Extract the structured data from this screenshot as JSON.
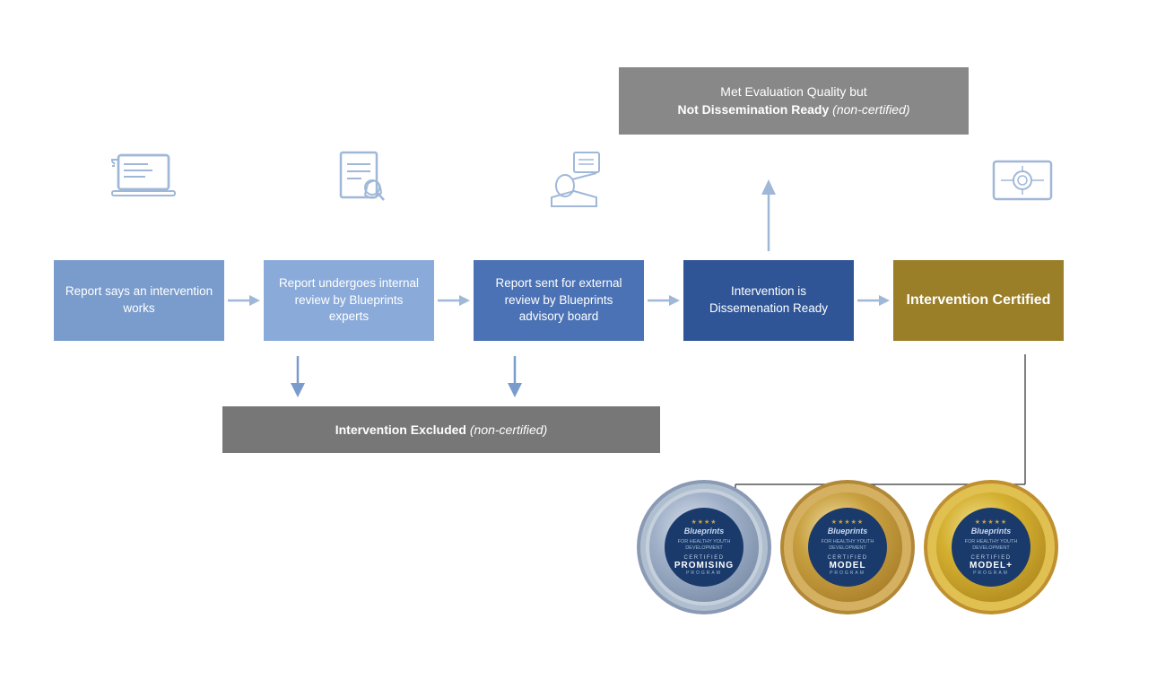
{
  "diagram": {
    "topBox": {
      "line1": "Met Evaluation Quality but",
      "line2Bold": "Not Dissemination Ready",
      "line2Italic": "(non-certified)"
    },
    "flowBoxes": [
      {
        "id": "box1",
        "text": "Report says an intervention works"
      },
      {
        "id": "box2",
        "text": "Report undergoes internal review by Blueprints experts"
      },
      {
        "id": "box3",
        "text": "Report sent for external review by Blueprints advisory board"
      },
      {
        "id": "box4",
        "text": "Intervention is Dissemenation Ready"
      },
      {
        "id": "box5",
        "text": "Intervention Certified"
      }
    ],
    "excludedBox": {
      "bold": "Intervention Excluded",
      "italic": "(non-certified)"
    },
    "badges": [
      {
        "type": "promising",
        "label": "CERTIFIED",
        "sub": "PROMISING",
        "program": "PROGRAM"
      },
      {
        "type": "model",
        "label": "CERTIFIED",
        "sub": "MODEL",
        "program": "PROGRAM"
      },
      {
        "type": "modelplus",
        "label": "CERTIFIED",
        "sub": "MODEL+",
        "program": "PROGRAM"
      }
    ],
    "icons": [
      {
        "name": "laptop-icon"
      },
      {
        "name": "document-review-icon"
      },
      {
        "name": "presentation-icon"
      },
      {
        "name": "arrow-up-icon"
      },
      {
        "name": "certificate-icon"
      }
    ]
  }
}
